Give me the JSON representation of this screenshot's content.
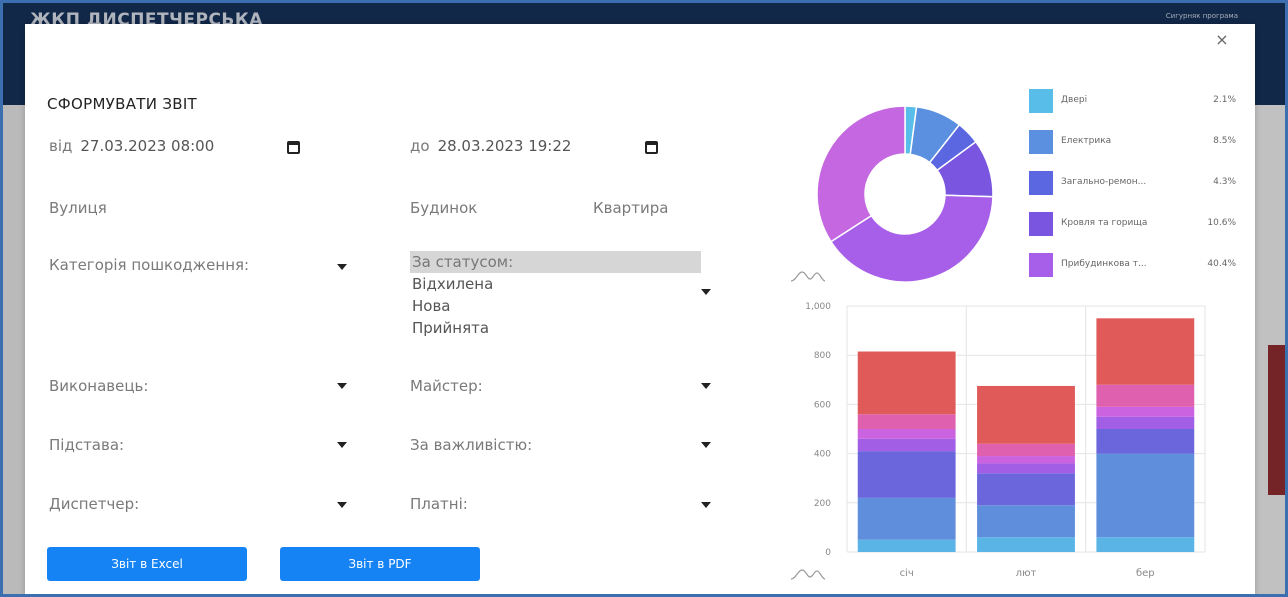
{
  "app": {
    "title": "ЖКП ДИСПЕТЧЕРСЬКА",
    "user_link": "Сигурняк програма"
  },
  "modal": {
    "close_symbol": "×",
    "title": "СФОРМУВАТИ ЗВІТ",
    "date_from": {
      "label": "від",
      "value": "27.03.2023 08:00"
    },
    "date_to": {
      "label": "до",
      "value": "28.03.2023 19:22"
    },
    "fields": {
      "street": "Вулиця",
      "building": "Будинок",
      "apartment": "Квартира",
      "damage_category": "Категорія пошкодження:",
      "executor": "Виконавець:",
      "master": "Майстер:",
      "basis": "Підстава:",
      "importance": "За важливістю:",
      "dispatcher": "Диспетчер:",
      "paid": "Платні:"
    },
    "status_list": {
      "header": "За статусом:",
      "options": [
        "Відхилена",
        "Нова",
        "Прийнята"
      ]
    },
    "buttons": {
      "excel": "Звіт в Excel",
      "pdf": "Звіт в PDF"
    }
  },
  "legend": [
    {
      "label": "Двері",
      "pct": "2.1%",
      "color": "#58bde8"
    },
    {
      "label": "Електрика",
      "pct": "8.5%",
      "color": "#5b8fe0"
    },
    {
      "label": "Загально-ремон...",
      "pct": "4.3%",
      "color": "#5b67e0"
    },
    {
      "label": "Кровля та горища",
      "pct": "10.6%",
      "color": "#7a55e0"
    },
    {
      "label": "Прибудинкова т...",
      "pct": "40.4%",
      "color": "#a75ee8"
    }
  ],
  "chart_data": [
    {
      "type": "pie",
      "variant": "donut",
      "slices": [
        {
          "label": "Двері",
          "value": 2.1,
          "color": "#58bde8"
        },
        {
          "label": "Електрика",
          "value": 8.5,
          "color": "#5b8fe0"
        },
        {
          "label": "Загально-ремон...",
          "value": 4.3,
          "color": "#5b67e0"
        },
        {
          "label": "Кровля та горища",
          "value": 10.6,
          "color": "#7a55e0"
        },
        {
          "label": "Прибудинкова т...",
          "value": 40.4,
          "color": "#a75ee8"
        },
        {
          "value": 34.1,
          "color": "#c567e0"
        }
      ],
      "legend_position": "right"
    },
    {
      "type": "bar",
      "stacked": true,
      "categories": [
        "січ",
        "лют",
        "бер"
      ],
      "ylim": [
        0,
        1000
      ],
      "yticks": [
        "0",
        "200",
        "400",
        "600",
        "800",
        "1,000"
      ],
      "grid": true,
      "series": [
        {
          "values": [
            50,
            60,
            60
          ],
          "color": "#5ab5e6"
        },
        {
          "values": [
            170,
            130,
            340
          ],
          "color": "#5f8fdc"
        },
        {
          "values": [
            190,
            130,
            100
          ],
          "color": "#6b66dc"
        },
        {
          "values": [
            50,
            40,
            50
          ],
          "color": "#a25fe6"
        },
        {
          "values": [
            40,
            30,
            40
          ],
          "color": "#cb63e0"
        },
        {
          "values": [
            60,
            50,
            90
          ],
          "color": "#e060b0"
        },
        {
          "values": [
            255,
            235,
            270
          ],
          "color": "#e05a5a"
        }
      ]
    }
  ]
}
